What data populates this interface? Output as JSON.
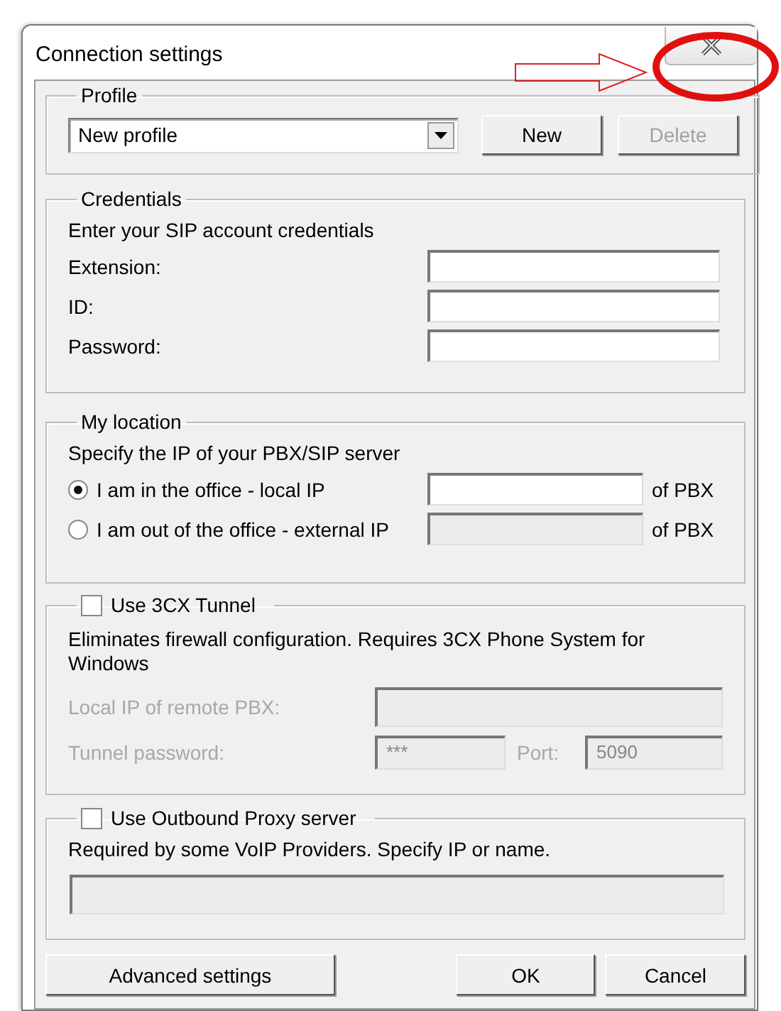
{
  "window": {
    "title": "Connection settings"
  },
  "profile": {
    "legend": "Profile",
    "selected_profile": "New profile",
    "buttons": [
      {
        "label": "New",
        "disabled": false
      },
      {
        "label": "Delete",
        "disabled": true
      }
    ]
  },
  "credentials": {
    "legend": "Credentials",
    "instruction": "Enter your SIP account credentials",
    "fields": [
      {
        "label": "Extension:"
      },
      {
        "label": "ID:"
      },
      {
        "label": "Password:"
      }
    ]
  },
  "location": {
    "legend": "My location",
    "instruction": "Specify the IP of your PBX/SIP server",
    "options": [
      {
        "label": "I am in the office - local IP",
        "selected": true,
        "suffix": "of PBX"
      },
      {
        "label": "I am out of the office - external IP",
        "selected": false,
        "suffix": "of PBX"
      }
    ]
  },
  "tunnel": {
    "label": "Use 3CX Tunnel",
    "checked": false,
    "description": "Eliminates firewall configuration. Requires 3CX Phone System for Windows",
    "local_ip_label": "Local IP of remote PBX:",
    "password_label": "Tunnel password:",
    "password_value": "***",
    "port_label": "Port:",
    "port_value": "5090"
  },
  "proxy": {
    "label": "Use Outbound Proxy server",
    "checked": false,
    "description": "Required by some VoIP Providers. Specify IP or name."
  },
  "buttons": [
    {
      "label": "Advanced settings",
      "kind": "left"
    },
    {
      "label": "OK",
      "kind": "right"
    },
    {
      "label": "Cancel",
      "kind": "right"
    }
  ]
}
